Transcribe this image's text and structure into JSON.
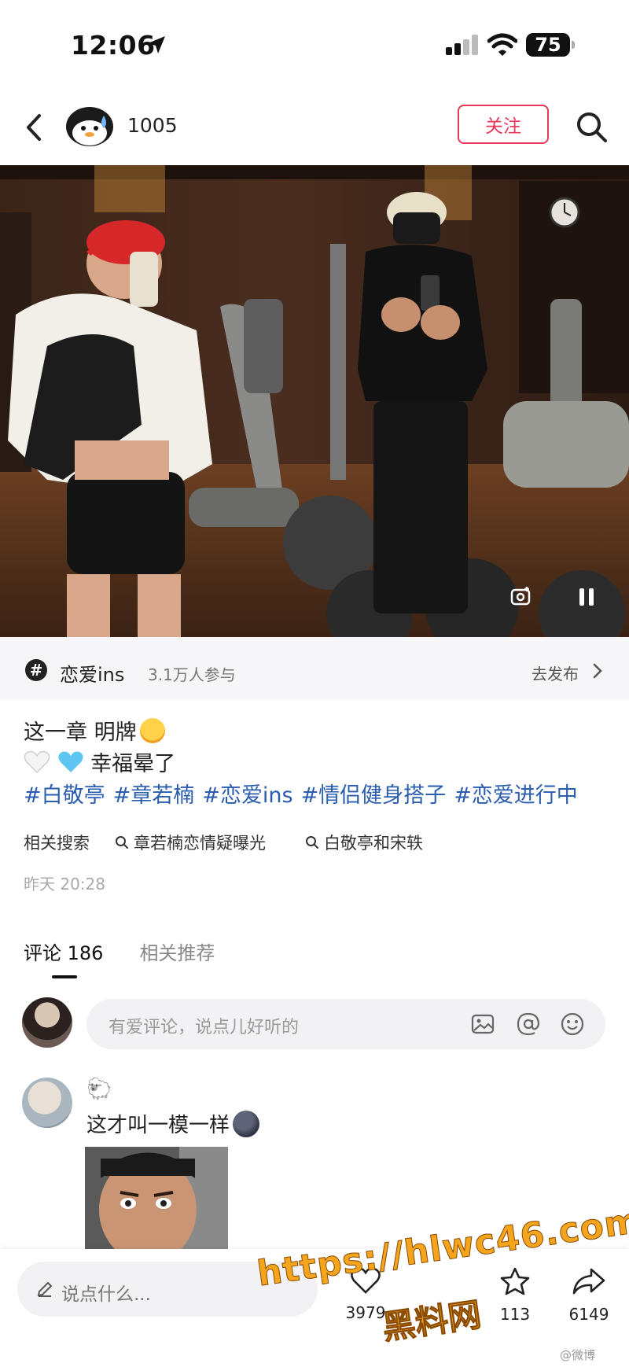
{
  "status": {
    "time": "12:06",
    "battery": "75"
  },
  "nav": {
    "username": "1005",
    "follow_label": "关注"
  },
  "topic": {
    "name": "恋爱ins",
    "count": "3.1万人参与",
    "action": "去发布"
  },
  "caption": {
    "line1": "这一章 明牌",
    "line2": "幸福晕了",
    "hashtags": [
      "#白敬亭",
      "#章若楠",
      "#恋爱ins",
      "#情侣健身搭子",
      "#恋爱进行中"
    ]
  },
  "related": {
    "label": "相关搜索",
    "queries": [
      "章若楠恋情疑曝光",
      "白敬亭和宋轶"
    ]
  },
  "post_time": "昨天 20:28",
  "tabs": {
    "comments": "评论 186",
    "recommend": "相关推荐"
  },
  "comment_box": {
    "placeholder": "有爱评论，说点儿好听的"
  },
  "comment": {
    "emoji": "🐑",
    "text": "这才叫一模一样"
  },
  "bottom": {
    "say_placeholder": "说点什么...",
    "likes": "3979",
    "stars": "113",
    "shares": "6149"
  },
  "watermark": {
    "url": "https://hlwc46.com",
    "name": "黑料网",
    "small": "@微博"
  },
  "colors": {
    "accent": "#e8375a",
    "hashtag": "#2a5db0",
    "watermark": "#f5a41e"
  }
}
